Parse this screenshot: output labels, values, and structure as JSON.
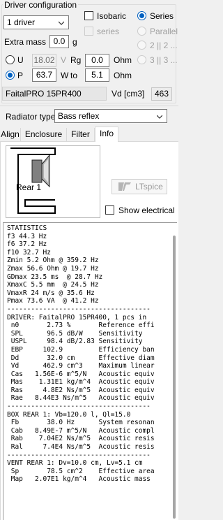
{
  "driver_config": {
    "group_title": "Driver configuration",
    "count_select": "1 driver",
    "isobaric_label": "Isobaric",
    "series_small_label": "series",
    "series_label": "Series",
    "parallel_label": "Parallel",
    "p2_label": "2 || 2 ...",
    "p3_label": "3 || 3 ...",
    "extra_mass_label": "Extra mass",
    "extra_mass_value": "0.0",
    "extra_mass_unit": "g",
    "u_label": "U",
    "u_value": "18.02",
    "u_unit": "V",
    "rg_label": "Rg",
    "rg_value": "0.0",
    "rg_unit": "Ohm",
    "p_label": "P",
    "p_value": "63.7",
    "p_unit": "W",
    "to_label": "to",
    "to_value": "5.1",
    "to_unit": "Ohm",
    "driver_name": "FaitalPRO 15PR400",
    "vd_label": "Vd [cm3]",
    "vd_value": "463"
  },
  "radiator": {
    "label": "Radiator type",
    "value": "Bass reflex"
  },
  "tabs": [
    "Align",
    "Enclosure",
    "Filter",
    "Info"
  ],
  "diagram": {
    "label": "Rear 1"
  },
  "ltspice_label": "LTspice",
  "show_electrical_label": "Show electrical",
  "output_text": "STATISTICS\nf3 44.3 Hz\nf6 37.2 Hz\nf10 32.7 Hz\nZmin 5.2 Ohm @ 359.2 Hz\nZmax 56.6 Ohm @ 19.7 Hz\nGDmax 23.5 ms  @ 28.7 Hz\nXmaxC 5.5 mm  @ 24.5 Hz\nVmaxR 24 m/s @ 35.6 Hz\nPmax 73.6 VA  @ 41.2 Hz\n------------------------------------\nDRIVER: FaitalPRO 15PR400, 1 pcs in\n n0       2.73 %       Reference effi\n SPL      96.5 dB/W    Sensitivity\n USPL     98.4 dB/2.83 Sensitivity\n EBP     102.9         Efficiency ban\n Dd       32.0 cm      Effective diam\n Vd      462.9 cm^3    Maximum linear\n Cas   1.56E-6 m^5/N   Acoustic equiv\n Mas    1.31E1 kg/m^4  Acoustic equiv\n Ras     4.8E2 Ns/m^5  Acoustic equiv\n Rae   8.44E3 Ns/m^5   Acoustic equiv\n------------------------------------\nBOX REAR 1: Vb=120.0 l, Ql=15.0\n Fb       38.0 Hz      System resonan\n Cab   8.49E-7 m^5/N   Acoustic compl\n Rab    7.04E2 Ns/m^5  Acoustic resis\n Ral     7.4E4 Ns/m^5  Acoustic resis\n------------------------------------\nVENT REAR 1: Dv=10.0 cm, Lv=5.1 cm\n Sp       78.5 cm^2    Effective area\n Map   2.07E1 kg/m^4   Acoustic mass"
}
